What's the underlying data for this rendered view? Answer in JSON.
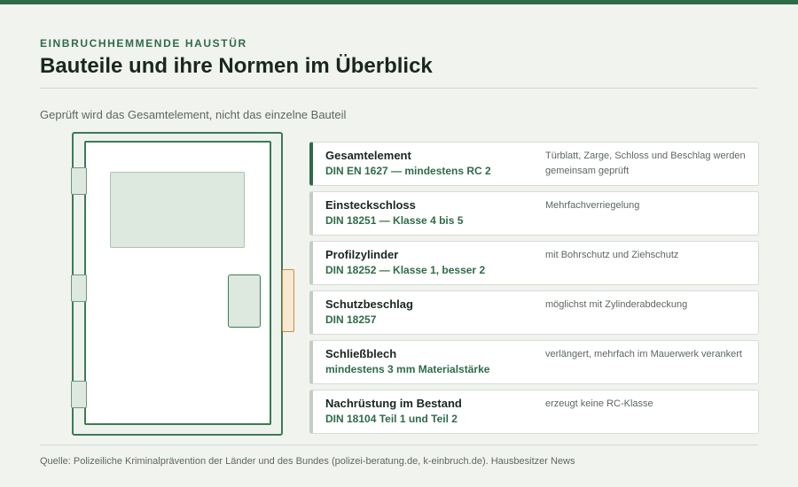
{
  "header": {
    "kicker": "EINBRUCHHEMMENDE HAUSTÜR",
    "title": "Bauteile und ihre Normen im Überblick",
    "subtitle": "Geprüft wird das Gesamtelement, nicht das einzelne Bauteil"
  },
  "colors": {
    "accent": "#2f6b49",
    "strike_plate": "#c98f3f",
    "background": "#f1f3ef"
  },
  "components": [
    {
      "name": "Gesamtelement",
      "norm": "DIN EN 1627 — mindestens RC 2",
      "note": "Türblatt, Zarge, Schloss und Beschlag werden gemeinsam geprüft",
      "highlighted": true
    },
    {
      "name": "Einsteckschloss",
      "norm": "DIN 18251 — Klasse 4 bis 5",
      "note": "Mehrfachverriegelung",
      "highlighted": false
    },
    {
      "name": "Profilzylinder",
      "norm": "DIN 18252 — Klasse 1, besser 2",
      "note": "mit Bohrschutz und Ziehschutz",
      "highlighted": false
    },
    {
      "name": "Schutzbeschlag",
      "norm": "DIN 18257",
      "note": "möglichst mit Zylinderabdeckung",
      "highlighted": false
    },
    {
      "name": "Schließblech",
      "norm": "mindestens 3 mm Materialstärke",
      "note": "verlängert, mehrfach im Mauerwerk verankert",
      "highlighted": false
    },
    {
      "name": "Nachrüstung im Bestand",
      "norm": "DIN 18104 Teil 1 und Teil 2",
      "note": "erzeugt keine RC-Klasse",
      "highlighted": false
    }
  ],
  "footer": {
    "source": "Quelle: Polizeiliche Kriminalprävention der Länder und des Bundes (polizei-beratung.de, k-einbruch.de). Hausbesitzer News"
  }
}
